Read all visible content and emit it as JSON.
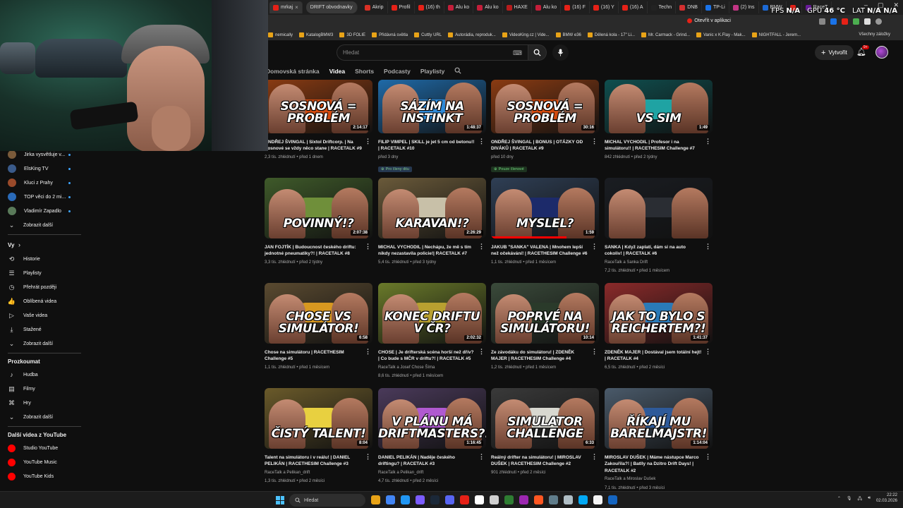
{
  "browser": {
    "tabs": [
      {
        "label": "mrkaj",
        "color": "#e62117",
        "active": true
      },
      {
        "label": "DRIFT obvodnavky",
        "color": "#555555",
        "drift": true
      },
      {
        "label": "Akrip",
        "color": "#d93025"
      },
      {
        "label": "Profil",
        "color": "#e62117"
      },
      {
        "label": "(16) th",
        "color": "#e62117"
      },
      {
        "label": "Alu ko",
        "color": "#c41e3a"
      },
      {
        "label": "Alu ko",
        "color": "#c41e3a"
      },
      {
        "label": "HAXE",
        "color": "#b71c1c"
      },
      {
        "label": "Alu ko",
        "color": "#c41e3a"
      },
      {
        "label": "(16) F",
        "color": "#e62117"
      },
      {
        "label": "(16) Y",
        "color": "#e62117"
      },
      {
        "label": "(16) A",
        "color": "#e62117"
      },
      {
        "label": "Techn",
        "color": "#222222"
      },
      {
        "label": "DNB",
        "color": "#d32f2f"
      },
      {
        "label": "TP-Li",
        "color": "#1a73e8"
      },
      {
        "label": "(2) Ins",
        "color": "#c13584"
      },
      {
        "label": "BMW",
        "color": "#1c69d4"
      },
      {
        "label": "",
        "color": "#e62117"
      },
      {
        "label": "RaceT",
        "color": "#6a1b9a"
      }
    ],
    "window_buttons": [
      "–",
      "▢",
      "✕"
    ],
    "open_in_app_label": "Otevřít v aplikaci",
    "bookmarks": [
      "nemically",
      "KatalogBMW3",
      "3D FOLIE",
      "Přidávná světla",
      "Cuttly URL",
      "Autorádia, reproduk...",
      "VideoKing.cz | Vide...",
      "BMW e36",
      "Dělená kola - 17\" Li...",
      "Mr. Carmack - Grind...",
      "Vanic x K.Flay - Mak...",
      "NIGHTFALL - Jerem..."
    ],
    "all_bookmarks_label": "Všechny záložky"
  },
  "overlay_stats": {
    "fps_key": "FPS",
    "fps_val": "N/A",
    "gpu_key": "GPU",
    "gpu_val": "46 °C",
    "lat_key": "LAT",
    "lat_val": "N/A N/A"
  },
  "youtube": {
    "search_placeholder": "Hledat",
    "create_label": "Vytvořit",
    "notifications_badge": "9+",
    "channel_tabs": [
      "Domovská stránka",
      "Videa",
      "Shorts",
      "Podcasty",
      "Playlisty"
    ],
    "active_tab_index": 1
  },
  "sidebar": {
    "subscriptions": [
      {
        "label": "Jirka vysvětluje v...",
        "color": "#7a5a3a"
      },
      {
        "label": "ElsKing TV",
        "color": "#3a5a8a"
      },
      {
        "label": "Kluci z Prahy",
        "color": "#9a4a2a"
      },
      {
        "label": "TOP věci do 2 mi...",
        "color": "#2a6ab8"
      },
      {
        "label": "Vladimír Zapadlo",
        "color": "#5a7a5a"
      }
    ],
    "show_more_1": "Zobrazit další",
    "you_heading": "Vy",
    "you_items": [
      {
        "label": "Historie",
        "icon": "history-icon",
        "glyph": "⟲"
      },
      {
        "label": "Playlisty",
        "icon": "playlist-icon",
        "glyph": "☰"
      },
      {
        "label": "Přehrát později",
        "icon": "clock-icon",
        "glyph": "◷"
      },
      {
        "label": "Oblíbená videa",
        "icon": "thumbs-up-icon",
        "glyph": "👍"
      },
      {
        "label": "Vaše videa",
        "icon": "video-icon",
        "glyph": "▷"
      },
      {
        "label": "Stažené",
        "icon": "download-icon",
        "glyph": "⤓"
      },
      {
        "label": "Zobrazit další",
        "icon": "chevron-down-icon",
        "glyph": "⌄"
      }
    ],
    "explore_heading": "Prozkoumat",
    "explore_items": [
      {
        "label": "Hudba",
        "icon": "music-icon",
        "glyph": "♪"
      },
      {
        "label": "Filmy",
        "icon": "film-icon",
        "glyph": "▤"
      },
      {
        "label": "Hry",
        "icon": "gamepad-icon",
        "glyph": "⌘"
      },
      {
        "label": "Zobrazit další",
        "icon": "chevron-down-icon",
        "glyph": "⌄"
      }
    ],
    "more_heading": "Další videa z YouTube",
    "more_items": [
      {
        "label": "Studio YouTube"
      },
      {
        "label": "YouTube Music"
      },
      {
        "label": "YouTube Kids"
      }
    ]
  },
  "videos": [
    {
      "thumb_text": "SOSNOVÁ = PROBLÉM",
      "duration": "2:14:17",
      "title": "ONDŘEJ ŠVINGAL | Sixtol Driftcorp. | Na Sosnové se vždy něco stane | RACETALK #9",
      "meta1": "2,3 tis. zhlédnutí • před 1 dnem",
      "meta2": "",
      "badge": "",
      "bg": "#8a3b12",
      "car": "#d04a10",
      "progress": 0
    },
    {
      "thumb_text": "SÁZÍM NA INSTINKT",
      "duration": "1:48:37",
      "title": "FILIP VIMPEL | SKILL je jet 5 cm od betonu!! | RACETALK #10",
      "meta1": "před 3 dny",
      "meta2": "",
      "badge": "Pro členy ditu",
      "bg": "#1f6aa8",
      "car": "#2e8ad8",
      "progress": 0
    },
    {
      "thumb_text": "SOSNOVÁ = PROBLÉM",
      "duration": "30:16",
      "title": "ONDŘEJ ŠVINGAL | BONUS | OTÁZKY OD DIVÁKŮ | RACETALK #9",
      "meta1": "před 10 dny",
      "meta2": "",
      "badge": "Pouze členové",
      "bg": "#8a3b12",
      "car": "#d04a10",
      "progress": 0
    },
    {
      "thumb_text": "VS SIM",
      "duration": "1:49",
      "title": "MICHAL VYCHODIL | Profesor i na simulátoru!! | RACETHESIM Challenge #7",
      "meta1": "842 zhlédnutí • před 2 týdny",
      "meta2": "",
      "badge": "",
      "bg": "#0f4f4f",
      "car": "#1fa3a3",
      "progress": 0
    },
    {
      "thumb_text": "POVINNÝ!?",
      "duration": "2:07:38",
      "title": "JAN FOJTÍK | Budoucnost českého driftu: jednotné pneumatiky?! | RACETALK #8",
      "meta1": "3,3 tis. zhlédnutí • před 2 týdny",
      "meta2": "",
      "badge": "",
      "bg": "#3f5a2a",
      "car": "#6f8f3a",
      "progress": 0
    },
    {
      "thumb_text": "KARAVAN!?",
      "duration": "2:26:29",
      "title": "MICHAL VYCHODIL | Nechápu, že mě s tím nikdy nezastavila policie!| RACETALK #7",
      "meta1": "5,4 tis. zhlédnutí • před 3 týdny",
      "meta2": "",
      "badge": "",
      "bg": "#6a5a3a",
      "car": "#c8c0a8",
      "progress": 0
    },
    {
      "thumb_text": "MYSLEL?",
      "duration": "1:59",
      "title": "JAKUB \"SANKA\" VALENA | Mnohem lepší než očekávání! | RACETHESIM Challenge #6",
      "meta1": "1,1 tis. zhlédnutí • před 1 měsícem",
      "meta2": "",
      "badge": "",
      "bg": "#2f3f55",
      "car": "#1c2a6a",
      "progress": 70
    },
    {
      "thumb_text": "",
      "duration": "",
      "title": "SANKA | Když zaplatí, dám si na auto cokoliv! | RACETALK #6",
      "meta1": "RaceTalk a Sanka Drift",
      "meta2": "7,2 tis. zhlédnutí • před 1 měsícem",
      "badge": "",
      "bg": "#1a1d22",
      "car": "#2a2d33",
      "progress": 0
    },
    {
      "thumb_text": "CHOSE VS SIMULÁTOR!",
      "duration": "6:58",
      "title": "Chose na simulátoru | RACETHESIM Challenge #5",
      "meta1": "1,1 tis. zhlédnutí • před 1 měsícem",
      "meta2": "",
      "badge": "",
      "bg": "#5a4a30",
      "car": "#d89820",
      "progress": 0
    },
    {
      "thumb_text": "KONEC DRIFTU V ČR?",
      "duration": "2:02:32",
      "title": "CHOSE | Je drifterská scéna horší než dřív? | Co bude s MČR v driftu?! | RACETALK #5",
      "meta1": "RaceTalk a Josef Chose Šíma",
      "meta2": "8,6 tis. zhlédnutí • před 1 měsícem",
      "badge": "",
      "bg": "#6a7a2a",
      "car": "#b8a030",
      "progress": 0
    },
    {
      "thumb_text": "POPRVÉ NA SIMULÁTORU!",
      "duration": "10:14",
      "title": "Ze závodáku do simulátoru! | ZDENĚK MAJER | RACETHESIM Challenge #4",
      "meta1": "1,2 tis. zhlédnutí • před 1 měsícem",
      "meta2": "",
      "badge": "",
      "bg": "#3a4a3a",
      "car": "#2a3a2a",
      "progress": 0
    },
    {
      "thumb_text": "JAK TO BYLO S REICHERTEM?!",
      "duration": "1:41:37",
      "title": "ZDENĚK MAJER | Dostával jsem totální hejt! | RACETALK #4",
      "meta1": "6,5 tis. zhlédnutí • před 2 měsíci",
      "meta2": "",
      "badge": "",
      "bg": "#8a2a2a",
      "car": "#2a7ab8",
      "progress": 0
    },
    {
      "thumb_text": "ČISTÝ TALENT!",
      "duration": "8:04",
      "title": "Talent na simulátoru i v reálu! | DANIEL PELIKÁN | RACETHESIM Challenge #3",
      "meta1": "RaceTalk a Pelikan_drift",
      "meta2": "1,3 tis. zhlédnutí • před 2 měsíci",
      "badge": "",
      "bg": "#6a5a2a",
      "car": "#e8d040",
      "progress": 0
    },
    {
      "thumb_text": "V PLÁNU MÁ DRIFTMASTERS?!",
      "duration": "1:16:45",
      "title": "DANIEL PELIKÁN | Naděje českého driftingu? | RACETALK #3",
      "meta1": "RaceTalk a Pelikan_drift",
      "meta2": "4,7 tis. zhlédnutí • před 2 měsíci",
      "badge": "",
      "bg": "#4a3a5a",
      "car": "#b05ad0",
      "progress": 0
    },
    {
      "thumb_text": "SIMULATOR CHALLENGE",
      "duration": "6:33",
      "title": "Reálný drifter na simulátoru! | MIROSLAV DUŠEK | RACETHESIM Challenge #2",
      "meta1": "901 zhlédnutí • před 2 měsíci",
      "meta2": "",
      "badge": "",
      "bg": "#3a3a3a",
      "car": "#d8d8d0",
      "progress": 0
    },
    {
      "thumb_text": "ŘÍKAJÍ MU BARELMAJSTR!",
      "duration": "1:14:04",
      "title": "MIROSLAV DUŠEK | Máme nástupce Marco Zakouřila?! | Batlly na Dzitro Drift Days! | RACETALK #2",
      "meta1": "RaceTalk a Miroslav Dušek",
      "meta2": "7,1 tis. zhlédnutí • před 3 měsíci",
      "badge": "",
      "bg": "#4a5a6a",
      "car": "#2e5a9a",
      "progress": 0
    }
  ],
  "taskbar": {
    "search_label": "Hledat",
    "time": "22:22",
    "date": "02.03.2026",
    "apps": [
      "#e8a317",
      "#4285f4",
      "#2196f3",
      "#7b5cff",
      "#1b2838",
      "#5865f2",
      "#e62117",
      "#ffffff",
      "#d0d0d0",
      "#2e7d32",
      "#9c27b0",
      "#ff5722",
      "#607d8b",
      "#b0bec5",
      "#03a9f4",
      "#f5f5f5",
      "#1565c0"
    ]
  }
}
